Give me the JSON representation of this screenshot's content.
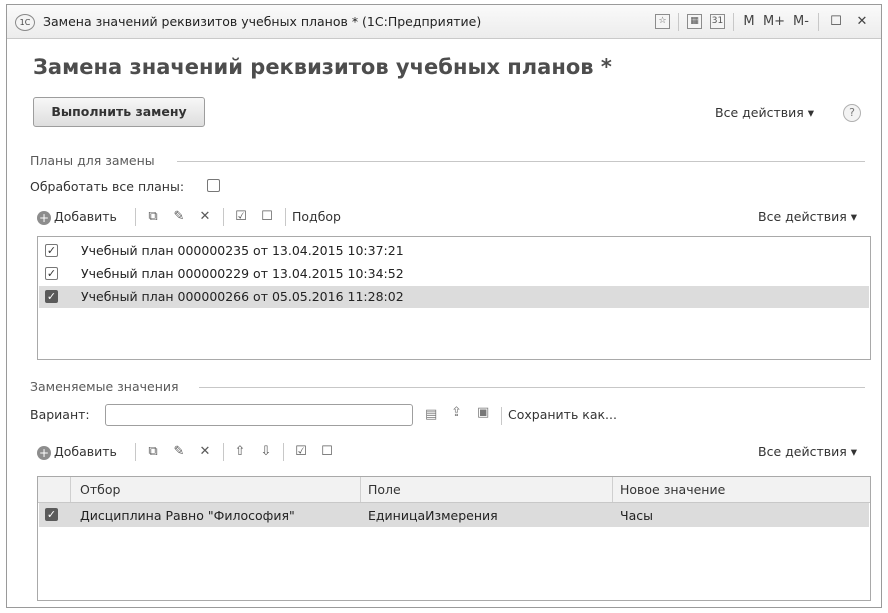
{
  "window": {
    "title": "Замена значений реквизитов учебных планов * (1С:Предприятие)",
    "logo": "1С",
    "buttons": [
      "M",
      "M+",
      "M-"
    ]
  },
  "form": {
    "heading": "Замена значений реквизитов учебных планов *",
    "run_button": "Выполнить замену",
    "all_actions": "Все действия ▾",
    "help": "?"
  },
  "plans": {
    "group_title": "Планы для замены",
    "process_all_label": "Обработать все планы:",
    "toolbar": {
      "add": "Добавить",
      "pick": "Подбор",
      "all_actions": "Все действия ▾"
    },
    "items": [
      {
        "label": "Учебный план 000000235 от 13.04.2015 10:37:21",
        "checked": true
      },
      {
        "label": "Учебный план 000000229 от 13.04.2015 10:34:52",
        "checked": true
      },
      {
        "label": "Учебный план 000000266 от 05.05.2016 11:28:02",
        "checked": true
      }
    ]
  },
  "replace": {
    "group_title": "Заменяемые значения",
    "variant_label": "Вариант:",
    "variant_value": "",
    "save_as": "Сохранить как...",
    "toolbar": {
      "add": "Добавить",
      "all_actions": "Все действия ▾"
    },
    "columns": [
      "Отбор",
      "Поле",
      "Новое значение"
    ],
    "rows": [
      {
        "filter": "Дисциплина Равно \"Философия\"",
        "field": "ЕдиницаИзмерения",
        "value": "Часы",
        "checked": true
      }
    ]
  },
  "colors": {
    "selection": "#dcdcdc",
    "border": "#a9a9a9"
  }
}
